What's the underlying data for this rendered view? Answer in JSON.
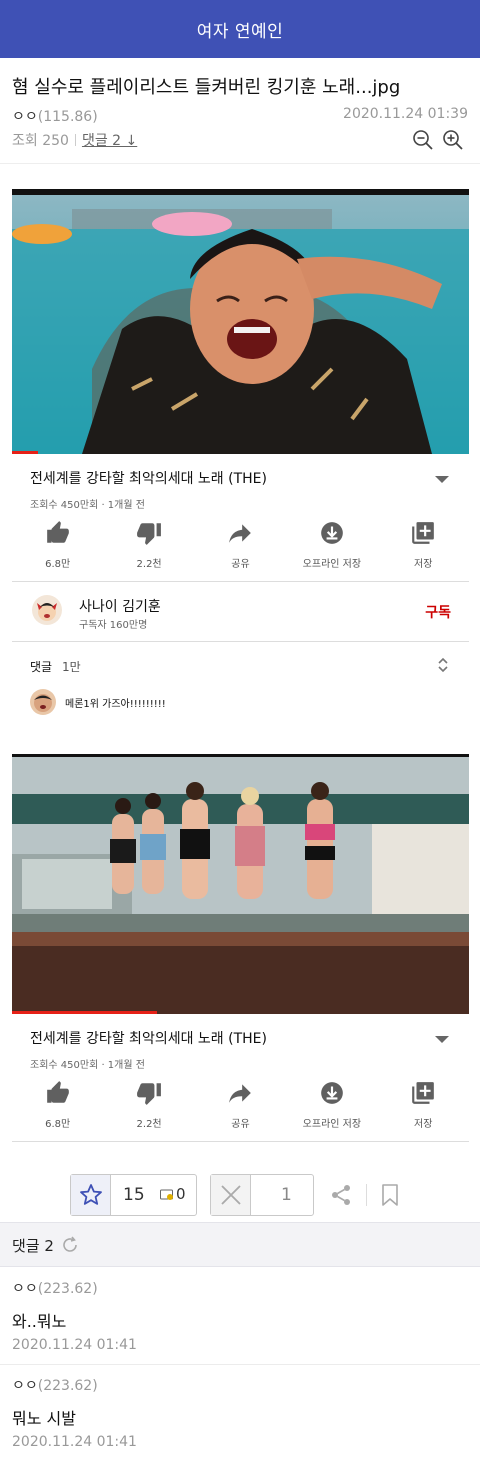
{
  "header": {
    "board_title": "여자 연예인"
  },
  "post": {
    "title": "혐 실수로 플레이리스트 들켜버린 킹기훈 노래...jpg",
    "author": "ㅇㅇ",
    "author_score": "(115.86)",
    "date": "2020.11.24 01:39",
    "views": "조회 250",
    "comment_link": "댓글 2 ↓",
    "zoom_out_icon": "zoom-out-icon",
    "zoom_in_icon": "zoom-in-icon"
  },
  "youtube": {
    "video_title": "전세계를 강타할 최악의세대 노래 (THE)",
    "meta": "조회수 450만회 · 1개월 전",
    "actions": [
      {
        "icon": "thumbs-up-icon",
        "label": "6.8만"
      },
      {
        "icon": "thumbs-down-icon",
        "label": "2.2천"
      },
      {
        "icon": "share-arrow-icon",
        "label": "공유"
      },
      {
        "icon": "download-icon",
        "label": "오프라인 저장"
      },
      {
        "icon": "add-playlist-icon",
        "label": "저장"
      }
    ],
    "channel_name": "사나이 김기훈",
    "channel_subs": "구독자 160만명",
    "subscribe_label": "구독",
    "comments_label": "댓글",
    "comments_count": "1만",
    "top_comment": "메론1위 가즈아!!!!!!!!!"
  },
  "votes": {
    "up_count": "15",
    "fix_count": "0",
    "down_count": "1"
  },
  "comments_section": {
    "label": "댓글 2",
    "comments": [
      {
        "author": "ㅇㅇ",
        "score": "(223.62)",
        "text": "와..뭐노",
        "date": "2020.11.24 01:41"
      },
      {
        "author": "ㅇㅇ",
        "score": "(223.62)",
        "text": "뭐노 시발",
        "date": "2020.11.24 01:41"
      }
    ]
  },
  "colors": {
    "header_bg": "#3f51b5",
    "subscribe_red": "#cc0000",
    "progress_red": "#e62117"
  }
}
